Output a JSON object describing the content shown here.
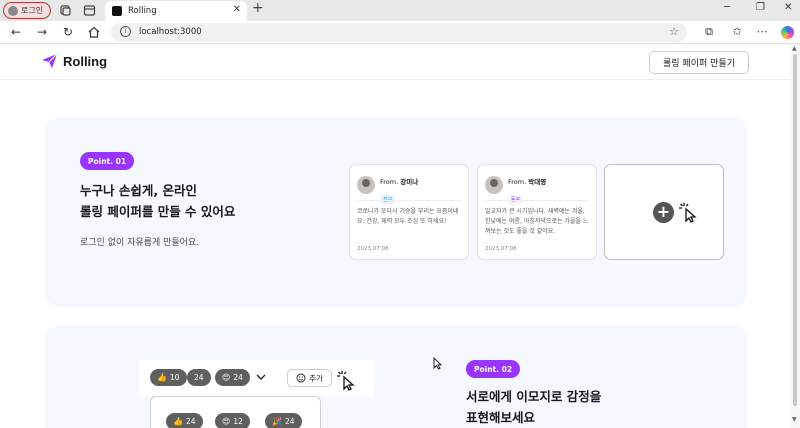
{
  "browser": {
    "profile_label": "로그인",
    "tab_title": "Rolling",
    "url": "localhost:3000",
    "accent": "#9935ff"
  },
  "header": {
    "brand": "Rolling",
    "make_button": "롤링 페이퍼 만들기"
  },
  "section1": {
    "pill": "Point. 01",
    "headline_line1": "누구나 손쉽게, 온라인",
    "headline_line2": "롤링 페이퍼를 만들 수 있어요",
    "subline": "로그인 없이 자유롭게 만들어요.",
    "cards": [
      {
        "from_prefix": "From.",
        "name": "강미나",
        "badge": "친구",
        "badge_color": "#e2f5ff",
        "badge_text_color": "#00a2fe",
        "body": "코로나가 또다시 기승을 부리는 요즘이네요. 건강, 체력 모두 조심 또 하세요!",
        "date": "2023.07.08"
      },
      {
        "from_prefix": "From.",
        "name": "박대영",
        "badge": "동료",
        "badge_color": "#f8f0ff",
        "badge_text_color": "#9935ff",
        "body": "일교차가 큰 시기입니다. 새벽에는 겨울, 한낮에는 여름, 아침저녁으로는 가을을 느껴보는 것도 좋을 것 같아요.",
        "date": "2023.07.08"
      }
    ]
  },
  "section2": {
    "pill": "Point. 02",
    "headline_line1": "서로에게 이모지로 감정을",
    "headline_line2": "표현해보세요",
    "reactions": [
      {
        "emoji": "👍",
        "count": "10"
      },
      {
        "emoji": "",
        "count": "24"
      },
      {
        "emoji": "😍",
        "count": "24"
      }
    ],
    "add_label": "추가",
    "popup_reactions": [
      {
        "emoji": "👍",
        "count": "24"
      },
      {
        "emoji": "😍",
        "count": "12"
      },
      {
        "emoji": "🎉",
        "count": "24"
      }
    ]
  }
}
